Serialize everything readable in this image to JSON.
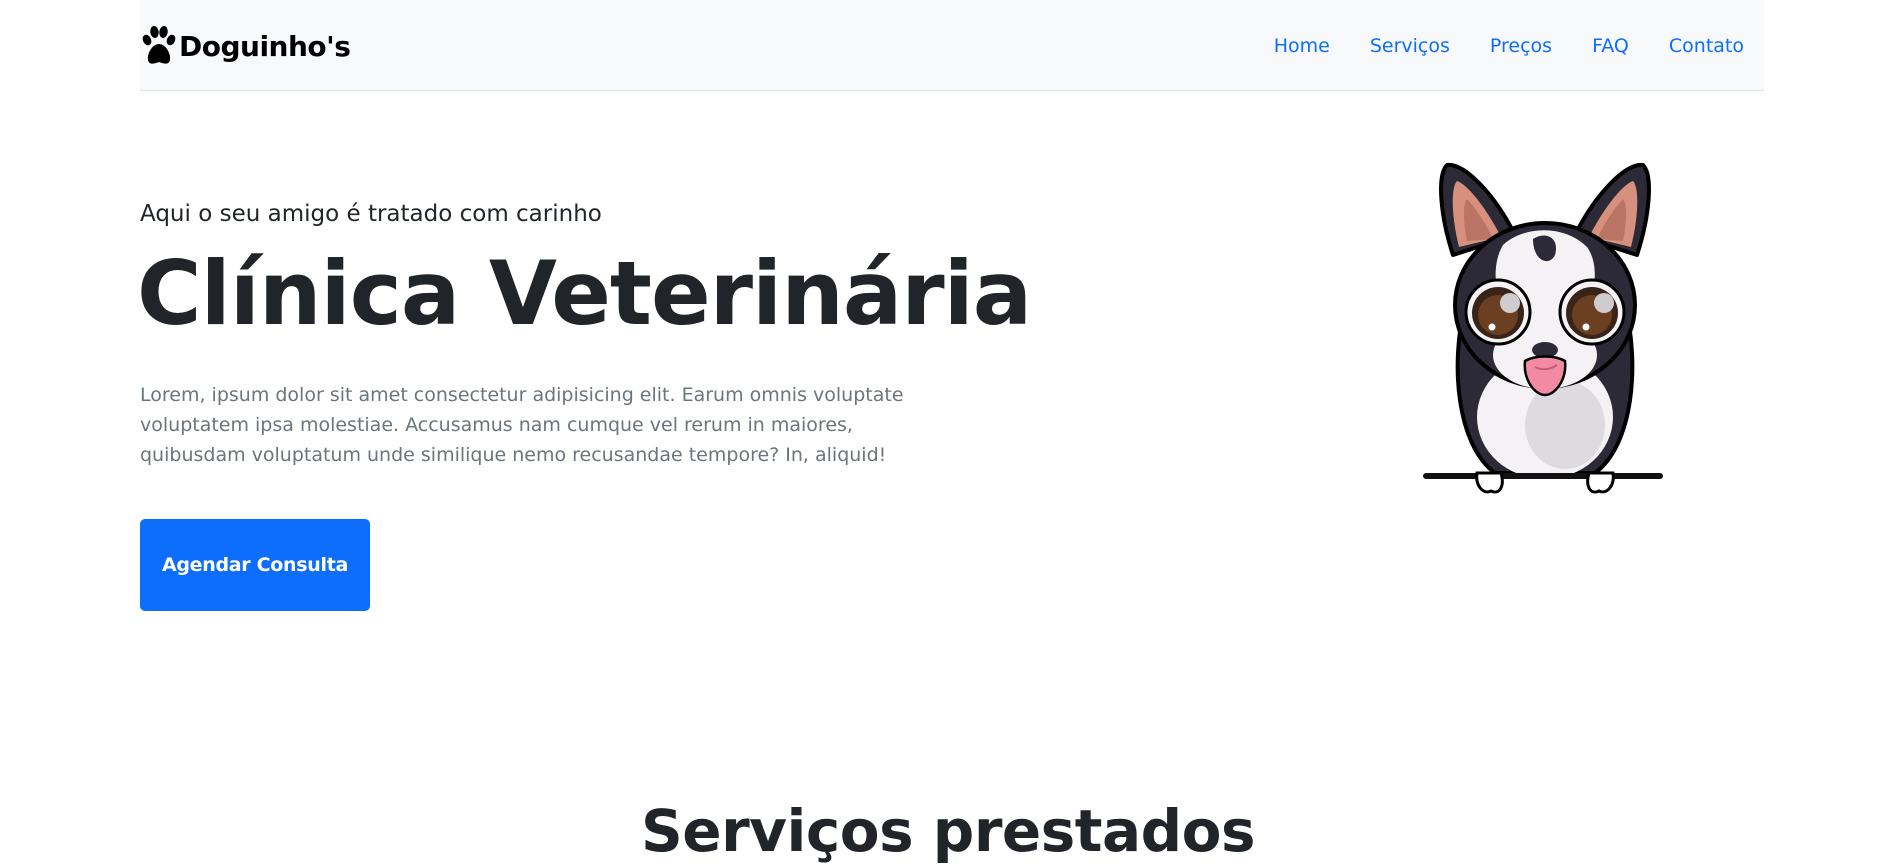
{
  "navbar": {
    "brand_name": "Doguinho's",
    "brand_icon": "paw-icon",
    "links": [
      {
        "label": "Home"
      },
      {
        "label": "Serviços"
      },
      {
        "label": "Preços"
      },
      {
        "label": "FAQ"
      },
      {
        "label": "Contato"
      }
    ]
  },
  "hero": {
    "tagline": "Aqui o seu amigo é tratado com carinho",
    "title": "Clínica Veterinária",
    "description": "Lorem, ipsum dolor sit amet consectetur adipisicing elit. Earum omnis voluptate voluptatem ipsa molestiae. Accusamus nam cumque vel rerum in maiores, quibusdam voluptatum unde similique nemo recusandae tempore? In, aliquid!",
    "cta_label": "Agendar Consulta",
    "illustration": "cartoon-dog"
  },
  "services": {
    "title": "Serviços prestados"
  },
  "colors": {
    "primary": "#0d6efd",
    "navbar_bg": "#f8f9fa",
    "text_dark": "#212529",
    "text_muted": "#6c757d"
  }
}
